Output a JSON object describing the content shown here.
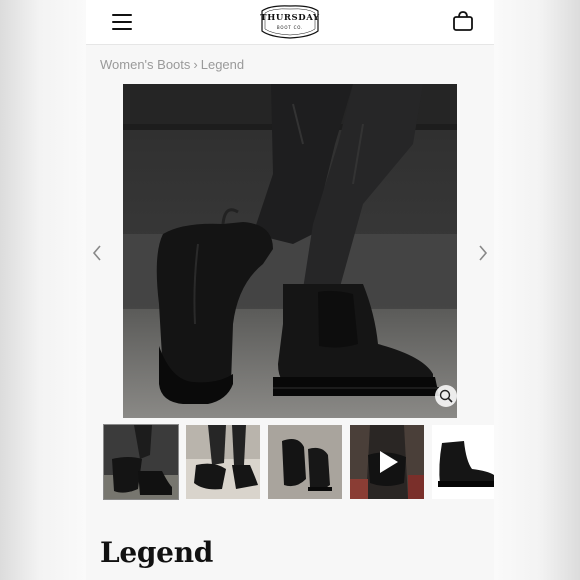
{
  "header": {
    "logo_name": "THURSDAY",
    "logo_sub": "BOOT CO.",
    "menu_icon": "hamburger-menu-icon",
    "cart_icon": "shopping-bag-icon"
  },
  "breadcrumb": {
    "parent": "Women's Boots",
    "separator": "›",
    "current": "Legend"
  },
  "gallery": {
    "thumbnails": [
      {
        "name": "thumbnail-1",
        "active": true
      },
      {
        "name": "thumbnail-2",
        "active": false
      },
      {
        "name": "thumbnail-3",
        "active": false
      },
      {
        "name": "thumbnail-4-video",
        "active": false
      },
      {
        "name": "thumbnail-5",
        "active": false
      }
    ]
  },
  "product": {
    "title": "Legend"
  },
  "colors": {
    "boot": "#161616",
    "background": "#f7f7f7",
    "breadcrumb_text": "#9a9a9a"
  }
}
